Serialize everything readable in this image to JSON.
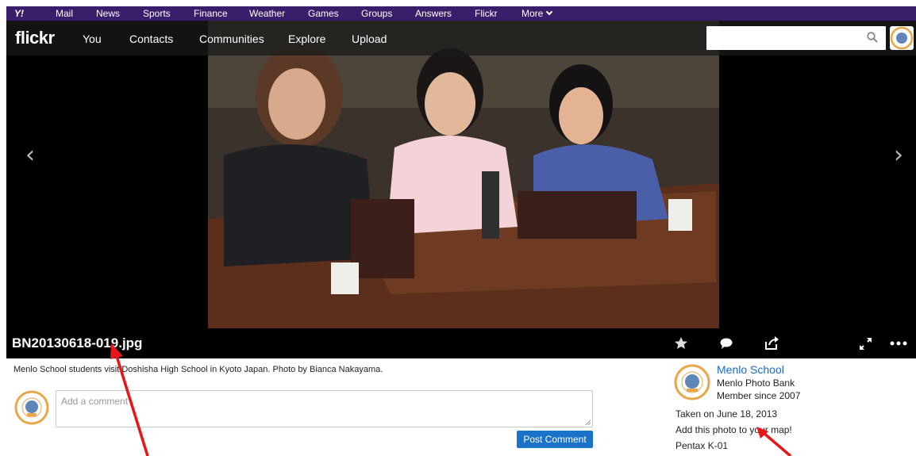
{
  "yahoo_bar": {
    "logo": "Y!",
    "items": [
      "Mail",
      "News",
      "Sports",
      "Finance",
      "Weather",
      "Games",
      "Groups",
      "Answers",
      "Flickr",
      "More"
    ]
  },
  "flickr_nav": {
    "logo": "flickr",
    "links": [
      "You",
      "Contacts",
      "Communities",
      "Explore",
      "Upload"
    ],
    "search_placeholder": ""
  },
  "photo": {
    "title": "BN20130618-019.jpg",
    "description": "Menlo School students visit Doshisha High School in Kyoto Japan. Photo by Bianca Nakayama."
  },
  "icons": {
    "prev": "chevron-left-icon",
    "next": "chevron-right-icon",
    "favorite": "star-icon",
    "comment": "comment-icon",
    "share": "share-icon",
    "fullscreen": "expand-icon",
    "more": "more-icon"
  },
  "comment": {
    "placeholder": "Add a comment",
    "post_label": "Post Comment"
  },
  "owner": {
    "name": "Menlo School",
    "subtitle": "Menlo Photo Bank",
    "member_since": "Member since 2007"
  },
  "meta": {
    "taken": "Taken on June 18, 2013",
    "map": "Add this photo to your map!",
    "camera": "Pentax K-01"
  },
  "colors": {
    "yahoo_purple": "#3b1e6b",
    "link_blue": "#1a6ac9",
    "button_blue": "#1a73c9",
    "annotation_red": "#e8161a"
  }
}
